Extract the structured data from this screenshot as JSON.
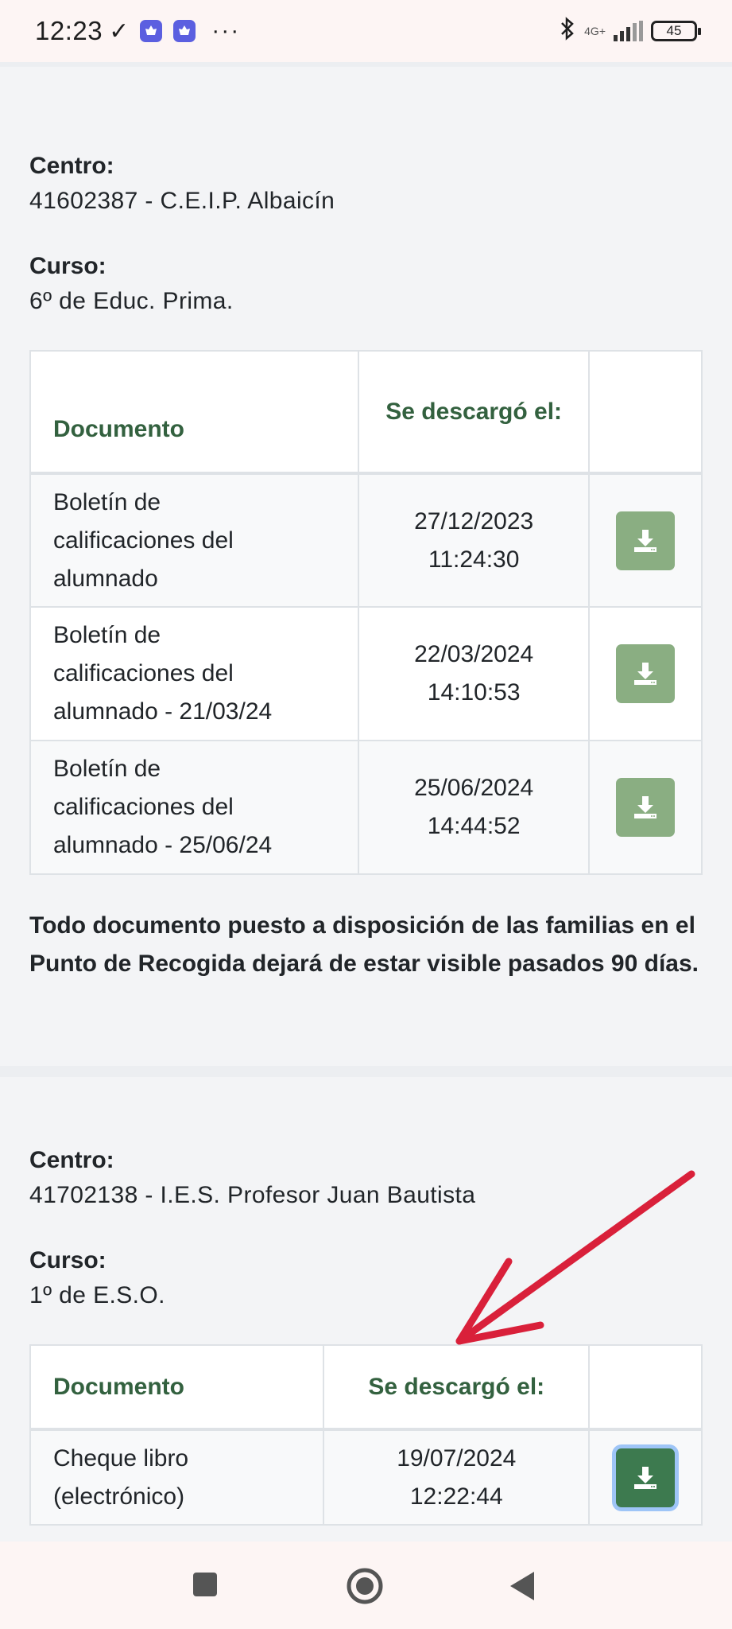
{
  "status_bar": {
    "time": "12:23",
    "check_glyph": "✓",
    "dots": "···",
    "network": "4G+",
    "battery": "45"
  },
  "sections": [
    {
      "centro_label": "Centro:",
      "centro_value": "41602387 - C.E.I.P. Albaicín",
      "curso_label": "Curso:",
      "curso_value": "6º de Educ. Prima.",
      "table": {
        "headers": [
          "Documento",
          "Se descargó el:",
          ""
        ],
        "rows": [
          {
            "doc_lines": [
              "Boletín de",
              "calificaciones del",
              "alumnado"
            ],
            "date": "27/12/2023",
            "time": "11:24:30"
          },
          {
            "doc_lines": [
              "Boletín de",
              "calificaciones del",
              "alumnado - 21/03/24"
            ],
            "date": "22/03/2024",
            "time": "14:10:53"
          },
          {
            "doc_lines": [
              "Boletín de",
              "calificaciones del",
              "alumnado - 25/06/24"
            ],
            "date": "25/06/2024",
            "time": "14:44:52"
          }
        ]
      },
      "note": "Todo documento puesto a disposición de las familias en el Punto de Recogida dejará de estar visible pasados 90 días."
    },
    {
      "centro_label": "Centro:",
      "centro_value": "41702138 - I.E.S. Profesor Juan Bautista",
      "curso_label": "Curso:",
      "curso_value": "1º de E.S.O.",
      "table": {
        "headers": [
          "Documento",
          "Se descargó el:",
          ""
        ],
        "rows": [
          {
            "doc_lines": [
              "Cheque libro",
              "(electrónico)"
            ],
            "date": "19/07/2024",
            "time": "12:22:44"
          }
        ]
      }
    }
  ],
  "icons": {
    "download": "download-icon",
    "arrow": "red-arrow-annotation",
    "nav_recent": "square-icon",
    "nav_home": "circle-icon",
    "nav_back": "triangle-back-icon"
  },
  "colors": {
    "header_green": "#33613f",
    "button_green_light": "#8aae82",
    "button_green_active": "#3d7a4f",
    "arrow_red": "#d9203a"
  }
}
